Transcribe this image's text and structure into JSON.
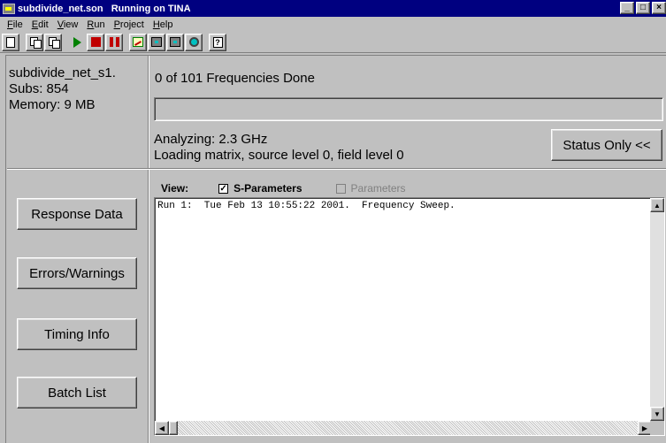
{
  "window": {
    "title": "subdivide_net.son   Running on TINA",
    "controls": [
      "minimize",
      "maximize",
      "close"
    ]
  },
  "menu": [
    "File",
    "Edit",
    "View",
    "Run",
    "Project",
    "Help"
  ],
  "toolbar": {
    "icons": [
      "new-document-icon",
      "copy-icon",
      "paste-icon",
      "run-icon",
      "stop-icon",
      "pause-icon",
      "response-chart-icon",
      "circuit-icon",
      "network-icon",
      "settings-icon",
      "help-icon"
    ]
  },
  "info": {
    "project_name": "subdivide_net_s1.",
    "subs": "Subs: 854",
    "memory": "Memory: 9 MB",
    "freq_status": "0 of 101 Frequencies Done",
    "progress_fraction": 0,
    "analyzing": "Analyzing: 2.3 GHz",
    "loading": "Loading matrix, source level 0, field level 0",
    "status_button": "Status Only <<"
  },
  "side_buttons": {
    "response": "Response Data",
    "errors": "Errors/Warnings",
    "timing": "Timing Info",
    "batch": "Batch List"
  },
  "view": {
    "label": "View:",
    "sparams_label": "S-Parameters",
    "sparams_checked": "✓",
    "params_label": "Parameters"
  },
  "log": {
    "line1": "Run 1:  Tue Feb 13 10:55:22 2001.  Frequency Sweep."
  },
  "colors": {
    "titlebar": "#000080",
    "face": "#c0c0c0"
  }
}
